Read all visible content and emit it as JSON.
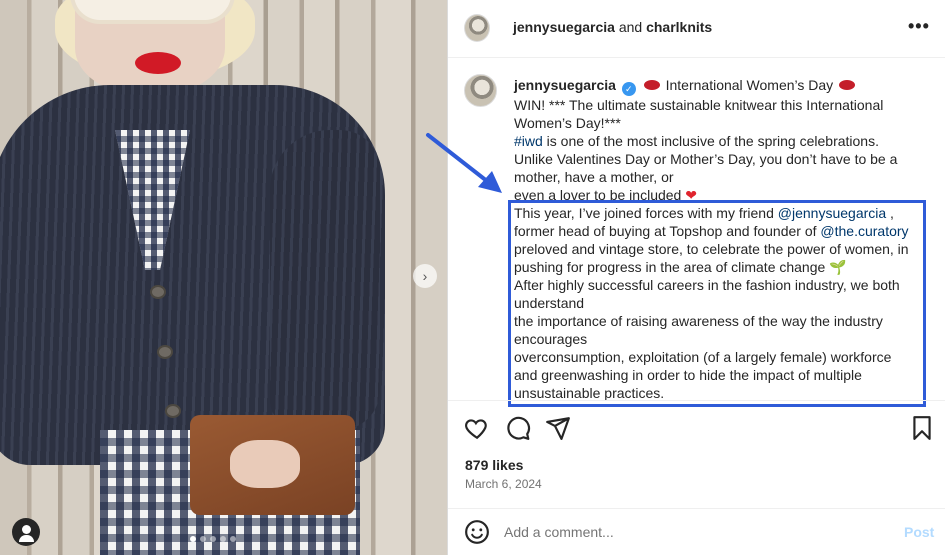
{
  "header": {
    "account": "jennysuegarcia",
    "joiner": " and ",
    "collaborator": "charlknits",
    "more_label": "•••"
  },
  "caption": {
    "username": "jennysuegarcia",
    "verified_mark": "✓",
    "title_text": " International Women’s Day ",
    "lines": [
      "WIN! *** The ultimate sustainable knitwear this International",
      "Women’s Day!***"
    ],
    "hashtag": "#iwd",
    "line_after_hashtag": " is one of the most inclusive of the spring celebrations.",
    "line2": "Unlike Valentines Day or Mother’s Day, you don’t have to be a",
    "line3": "mother, have a mother, or",
    "line4": "even a lover to be included ",
    "heart": "❤",
    "p2_a": "This year, I’ve joined forces with my friend ",
    "mention1": "@jennysuegarcia",
    "p2_b": " ,",
    "p2_c": "former head of buying at Topshop and founder of ",
    "mention2": "@the.curatory",
    "p2_d": "preloved and vintage store, to celebrate the power of women, in",
    "p2_e": "pushing for progress in the area of climate change ",
    "sprout": "🌱",
    "p3_a": "After highly successful careers in the fashion industry, we both",
    "p3_b": "understand",
    "p3_c": "the importance of raising awareness of the way the industry",
    "p3_d": "encourages",
    "p3_e": "overconsumption, exploitation (of a largely female) workforce",
    "p3_f": "and greenwashing in order to hide the impact of multiple",
    "p3_g": "unsustainable practices."
  },
  "stats": {
    "likes": "879 likes",
    "date": "March 6, 2024"
  },
  "comment": {
    "placeholder": "Add a comment...",
    "post_label": "Post"
  },
  "media": {
    "next_arrow": "›",
    "dot_count": 5
  },
  "colors": {
    "highlight": "#2f5bd8",
    "link": "#00376b",
    "post_disabled": "#b3dbff"
  }
}
